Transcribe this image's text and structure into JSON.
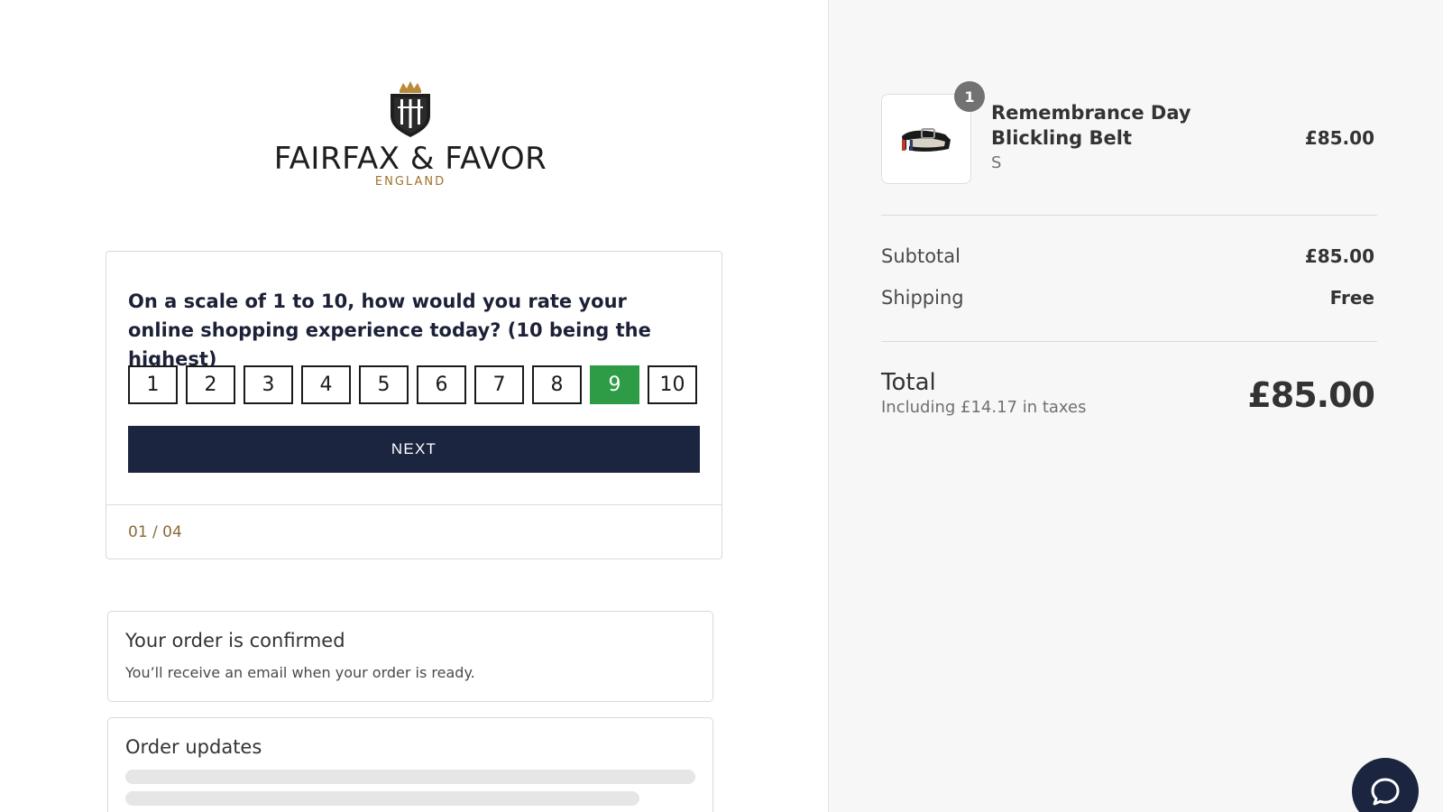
{
  "brand": {
    "name": "FAIRFAX & FAVOR",
    "subtitle": "ENGLAND"
  },
  "survey": {
    "question": "On a scale of 1 to 10, how would you rate your online shopping experience today? (10 being the highest)",
    "options": [
      "1",
      "2",
      "3",
      "4",
      "5",
      "6",
      "7",
      "8",
      "9",
      "10"
    ],
    "selected": "9",
    "next_label": "NEXT",
    "progress": "01 / 04",
    "colors": {
      "selected": "#2e9b46",
      "button": "#1c2540"
    }
  },
  "confirmation": {
    "title": "Your order is confirmed",
    "text": "You’ll receive an email when your order is ready."
  },
  "updates": {
    "title": "Order updates"
  },
  "summary": {
    "product": {
      "quantity": "1",
      "name": "Remembrance Day Blickling Belt",
      "variant": "S",
      "price": "£85.00"
    },
    "subtotal_label": "Subtotal",
    "subtotal_value": "£85.00",
    "shipping_label": "Shipping",
    "shipping_value": "Free",
    "total_label": "Total",
    "tax_note": "Including £14.17 in taxes",
    "total_value": "£85.00"
  },
  "chat": {
    "icon": "chat-bubble-icon"
  }
}
